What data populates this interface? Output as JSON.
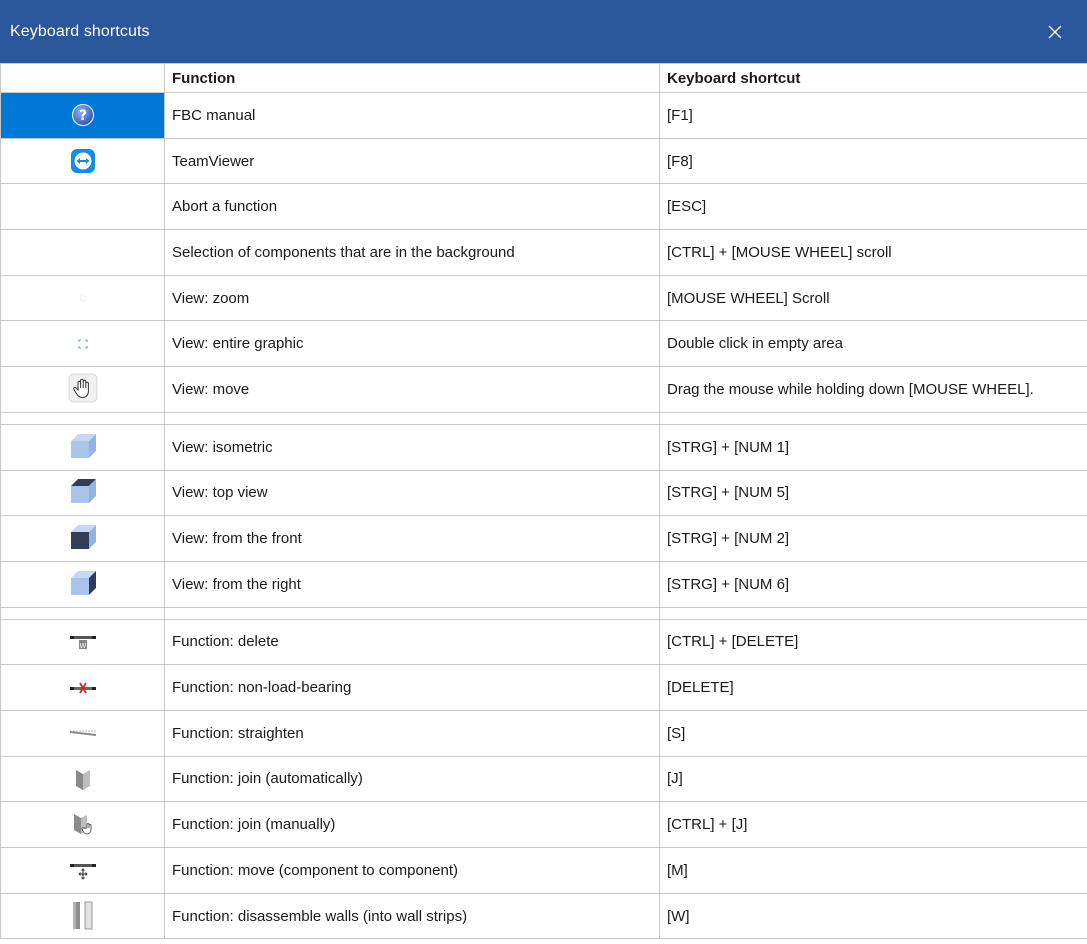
{
  "window": {
    "title": "Keyboard shortcuts"
  },
  "table": {
    "headers": {
      "function": "Function",
      "shortcut": "Keyboard shortcut"
    },
    "group1": [
      {
        "icon": "help-icon",
        "function": "FBC manual",
        "shortcut": "[F1]"
      },
      {
        "icon": "teamviewer-icon",
        "function": "TeamViewer",
        "shortcut": "[F8]"
      },
      {
        "icon": "",
        "function": "Abort a function",
        "shortcut": "[ESC]"
      },
      {
        "icon": "",
        "function": "Selection of components that are in the background",
        "shortcut": "[CTRL] + [MOUSE WHEEL] scroll"
      },
      {
        "icon": "zoom-icon",
        "function": "View: zoom",
        "shortcut": "[MOUSE WHEEL] Scroll"
      },
      {
        "icon": "zoom-extents-icon",
        "function": "View: entire graphic",
        "shortcut": "Double click in empty area"
      },
      {
        "icon": "hand-pan-icon",
        "function": "View: move",
        "shortcut": "Drag the mouse while holding down [MOUSE WHEEL]."
      }
    ],
    "group2": [
      {
        "icon": "cube-isometric-icon",
        "function": "View: isometric",
        "shortcut": "[STRG] + [NUM 1]"
      },
      {
        "icon": "cube-top-icon",
        "function": "View: top view",
        "shortcut": "[STRG] + [NUM 5]"
      },
      {
        "icon": "cube-front-icon",
        "function": "View: from the front",
        "shortcut": "[STRG] + [NUM 2]"
      },
      {
        "icon": "cube-right-icon",
        "function": "View: from the right",
        "shortcut": "[STRG] + [NUM 6]"
      }
    ],
    "group3": [
      {
        "icon": "wall-delete-icon",
        "function": "Function: delete",
        "shortcut": "[CTRL] + [DELETE]"
      },
      {
        "icon": "non-load-bearing-icon",
        "function": "Function: non-load-bearing",
        "shortcut": "[DELETE]"
      },
      {
        "icon": "straighten-icon",
        "function": "Function: straighten",
        "shortcut": "[S]"
      },
      {
        "icon": "join-auto-icon",
        "function": "Function: join (automatically)",
        "shortcut": "[J]"
      },
      {
        "icon": "join-manual-icon",
        "function": "Function: join (manually)",
        "shortcut": "[CTRL] + [J]"
      },
      {
        "icon": "move-component-icon",
        "function": "Function: move (component to component)",
        "shortcut": "[M]"
      },
      {
        "icon": "disassemble-walls-icon",
        "function": "Function: disassemble walls (into wall strips)",
        "shortcut": "[W]"
      }
    ]
  },
  "colors": {
    "titlebar": "#2b579a",
    "selection": "#0078d7",
    "grid": "#c8c8c8"
  }
}
